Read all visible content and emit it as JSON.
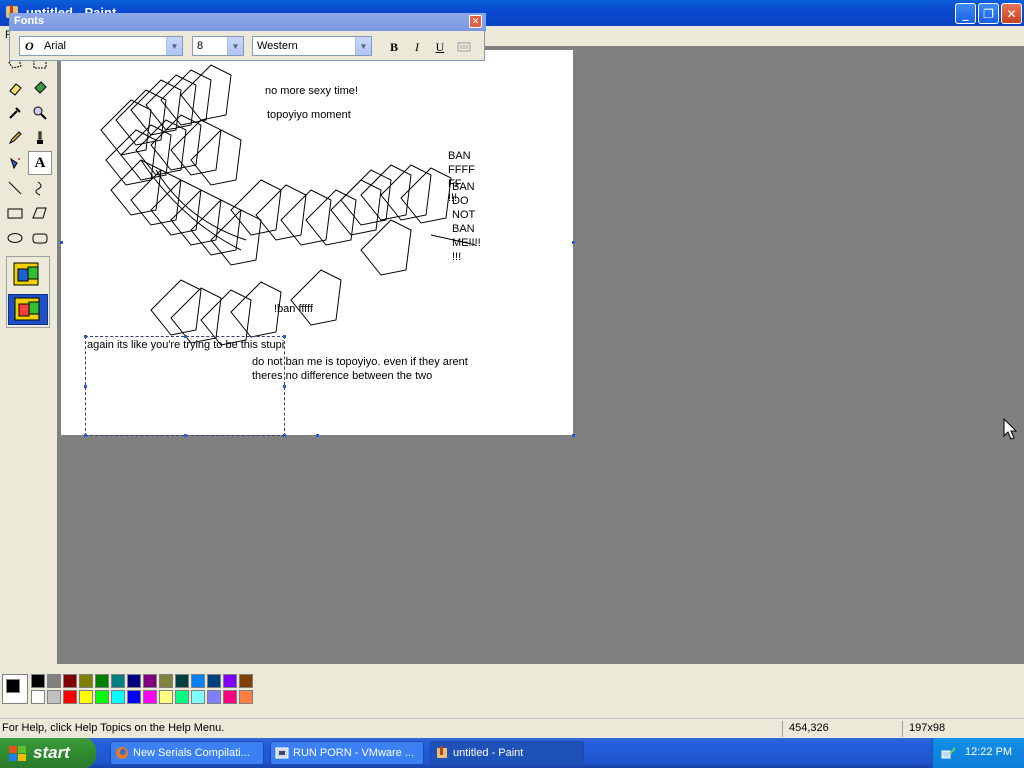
{
  "window": {
    "title": "untitled - Paint"
  },
  "menubar": {
    "first_item": "F"
  },
  "fonts_toolbar": {
    "title": "Fonts",
    "font_name": "Arial",
    "font_size": "8",
    "script": "Western",
    "bold_label": "B",
    "italic_label": "I",
    "underline_label": "U"
  },
  "canvas_texts": {
    "line1": "no more sexy time!",
    "line2": "topoyiyo moment",
    "ban1": "BAN\nFFFF\nFF\n!!!",
    "ban2": "BAN\nDO\nNOT\nBAN\nME!!!!\n!!!",
    "ban_small": "!ban fffff",
    "typing": "again its like you're trying to be this stupi",
    "reply": "do not ban me is topoyiyo. even if they arent\ntheres no difference between the two"
  },
  "palette": {
    "foreground": "#000000",
    "background": "#ffffff",
    "row1": [
      "#000000",
      "#808080",
      "#800000",
      "#808000",
      "#008000",
      "#008080",
      "#000080",
      "#800080",
      "#808040",
      "#004040",
      "#0080ff",
      "#004080",
      "#8000ff",
      "#804000"
    ],
    "row2": [
      "#ffffff",
      "#c0c0c0",
      "#ff0000",
      "#ffff00",
      "#00ff00",
      "#00ffff",
      "#0000ff",
      "#ff00ff",
      "#ffff80",
      "#00ff80",
      "#80ffff",
      "#8080ff",
      "#ff0080",
      "#ff8040"
    ]
  },
  "statusbar": {
    "help": "For Help, click Help Topics on the Help Menu.",
    "coords": "454,326",
    "size": "197x98"
  },
  "taskbar": {
    "start": "start",
    "tasks": [
      {
        "label": "New Serials Compilati..."
      },
      {
        "label": "RUN PORN - VMware ..."
      },
      {
        "label": "untitled - Paint"
      }
    ],
    "clock": "12:22 PM"
  }
}
